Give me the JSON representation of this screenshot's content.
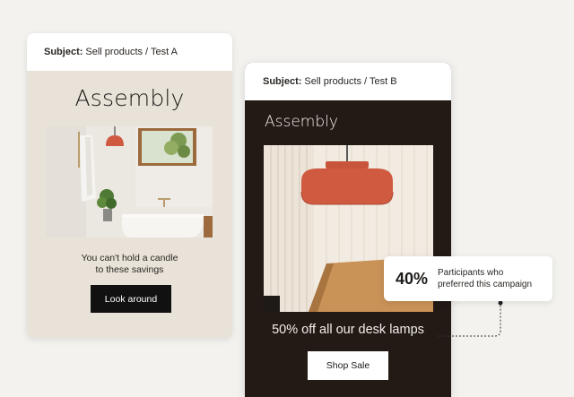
{
  "variant_a": {
    "subject_label": "Subject:",
    "subject_value": "Sell products / Test A",
    "brand": "Assembly",
    "tagline_line1": "You can't hold a candle",
    "tagline_line2": "to these savings",
    "button_label": "Look around",
    "background": "#e9e2d8"
  },
  "variant_b": {
    "subject_label": "Subject:",
    "subject_value": "Sell products  / Test B",
    "brand": "Assembly",
    "headline": "50% off all our desk lamps",
    "button_label": "Shop Sale",
    "background": "#231a16"
  },
  "stat": {
    "value": "40%",
    "desc_line1": "Participants who",
    "desc_line2": "preferred this campaign"
  },
  "colors": {
    "lamp": "#cf5a40",
    "page_background": "#f3f2ef"
  }
}
